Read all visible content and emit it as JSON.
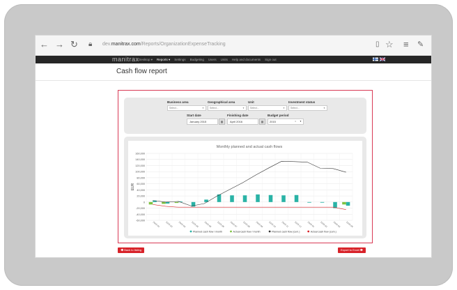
{
  "browser": {
    "url_prefix": "dev.",
    "url_host": "manitrax.com",
    "url_path": "/Reports/OrganizationExpenseTracking"
  },
  "app": {
    "brand": "manitrax",
    "nav": [
      "Desktop ▾",
      "Reports ▾",
      "Settings",
      "Budgeting",
      "Users",
      "Units",
      "Help and documents",
      "Sign out"
    ],
    "active_nav": "Reports ▾"
  },
  "page": {
    "title": "Cash flow report"
  },
  "filters": {
    "business_area": {
      "label": "Business area",
      "value": "Select..."
    },
    "geographical_area": {
      "label": "Geographical area",
      "value": "Select..."
    },
    "unit": {
      "label": "Unit",
      "value": "Select..."
    },
    "investment_status": {
      "label": "Investment status",
      "value": "Select..."
    },
    "start_date": {
      "label": "Start date",
      "value": "January 2015"
    },
    "finishing_date": {
      "label": "Finishing date",
      "value": "April 2016"
    },
    "budget_period": {
      "label": "Budget period",
      "value": "2015"
    }
  },
  "buttons": {
    "back": "Back to listing",
    "export": "Export to Excel"
  },
  "colors": {
    "appbar": "#262626",
    "accent_red": "#d8232a",
    "panel_border": "#d93a55",
    "planned_month": "#2ab3a6",
    "actual_month": "#7fc241",
    "planned_cum": "#333333",
    "actual_cum": "#d8232a"
  },
  "chart_data": {
    "type": "bar",
    "title": "Monthly planned and actual cash flows",
    "ylabel": "EUR",
    "ylim": [
      -60000,
      160000
    ],
    "yticks": [
      "160,000",
      "140,000",
      "120,000",
      "100,000",
      "80,000",
      "60,000",
      "40,000",
      "20,000",
      "0",
      "-20,000",
      "-40,000",
      "-60,000"
    ],
    "categories": [
      "2015-01",
      "2015-02",
      "2015-03",
      "2015-04",
      "2015-05",
      "2015-06",
      "2015-07",
      "2015-08",
      "2015-09",
      "2015-10",
      "2015-11",
      "2015-12",
      "2016-01",
      "2016-02",
      "2016-03",
      "2016-04"
    ],
    "series": [
      {
        "name": "Planned cash flow / month",
        "kind": "bar",
        "values": [
          5000,
          -5000,
          2000,
          -15000,
          8000,
          25000,
          22000,
          22000,
          25000,
          23000,
          22000,
          23000,
          -2000,
          -2000,
          -20000,
          -12000
        ]
      },
      {
        "name": "Actual cash flow / month",
        "kind": "bar",
        "values": [
          -8000,
          -6000,
          -3000,
          0,
          0,
          0,
          0,
          0,
          0,
          0,
          0,
          0,
          0,
          0,
          0,
          -8000
        ]
      },
      {
        "name": "Planned cash flow (cum.)",
        "kind": "line",
        "values": [
          5000,
          0,
          2000,
          -13000,
          -5000,
          20000,
          42000,
          64000,
          89000,
          112000,
          134000,
          133000,
          131000,
          111000,
          110000,
          98000
        ]
      },
      {
        "name": "Actual cash flow (cum.)",
        "kind": "line",
        "values": [
          -8000,
          -14000,
          -17000,
          -17000,
          -17000,
          -17000,
          -17000,
          -17000,
          -17000,
          -17000,
          -17000,
          -17000,
          -17000,
          -17000,
          -17000,
          -25000
        ]
      }
    ],
    "legend": "bottom",
    "grid": true
  }
}
